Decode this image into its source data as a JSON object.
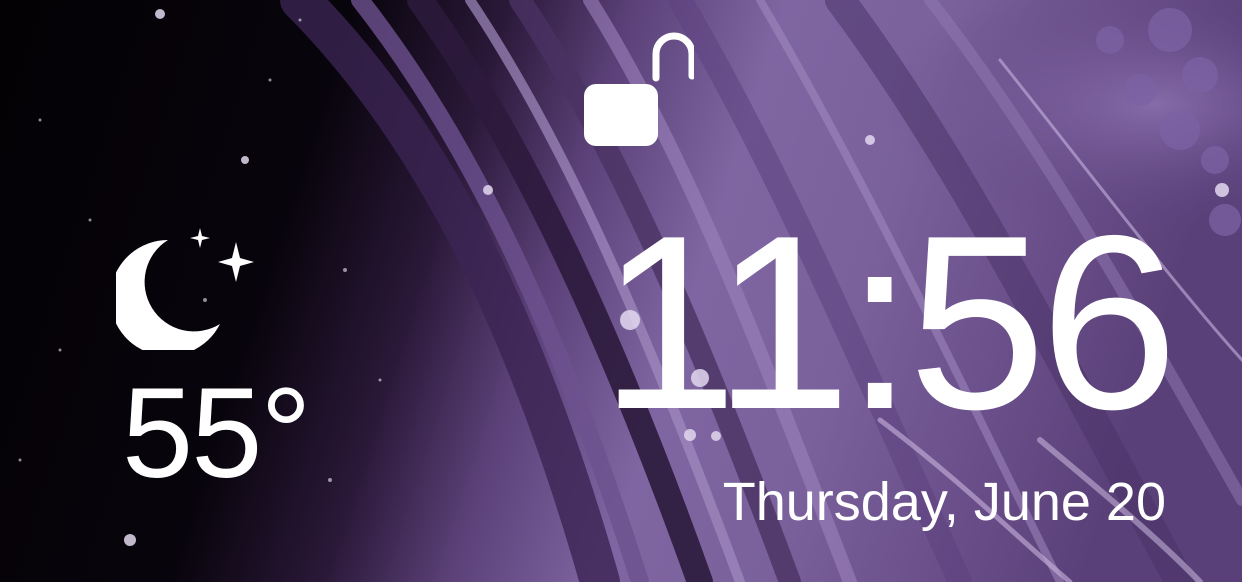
{
  "lock_screen": {
    "lock_state_icon": "unlocked-padlock-icon",
    "weather": {
      "icon": "moon-and-stars-icon",
      "temperature": "55°"
    },
    "clock": {
      "time": "11:56",
      "date": "Thursday, June 20"
    }
  },
  "colors": {
    "text": "#ffffff",
    "wallpaper_dark": "#050208",
    "wallpaper_purple": "#6e5490",
    "wallpaper_light_purple": "#9a84b8"
  }
}
